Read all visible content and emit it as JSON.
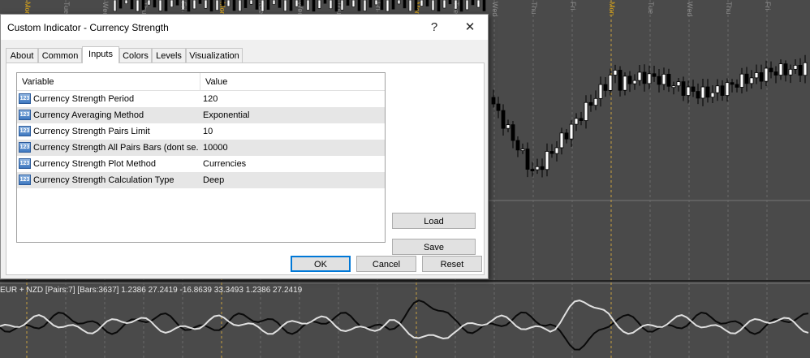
{
  "window": {
    "title": "Custom Indicator - Currency Strength",
    "help": "?",
    "close": "✕"
  },
  "tabs": [
    {
      "label": "About"
    },
    {
      "label": "Common"
    },
    {
      "label": "Inputs"
    },
    {
      "label": "Colors"
    },
    {
      "label": "Levels"
    },
    {
      "label": "Visualization"
    }
  ],
  "active_tab": "Inputs",
  "grid": {
    "headers": {
      "variable": "Variable",
      "value": "Value"
    },
    "rows": [
      {
        "name": "Currency Strength Period",
        "value": "120"
      },
      {
        "name": "Currency Averaging Method",
        "value": "Exponential"
      },
      {
        "name": "Currency Strength Pairs Limit",
        "value": "10"
      },
      {
        "name": "Currency Strength All Pairs Bars (dont se...",
        "value": "10000"
      },
      {
        "name": "Currency Strength Plot Method",
        "value": "Currencies"
      },
      {
        "name": "Currency Strength Calculation Type",
        "value": "Deep"
      }
    ],
    "icon_text": "123"
  },
  "buttons": {
    "load": "Load",
    "save": "Save",
    "ok": "OK",
    "cancel": "Cancel",
    "reset": "Reset"
  },
  "chart": {
    "indicator_label": "EUR + NZD [Pairs:7] [Bars:3637] 1.2386 27.2419 -16.8639 33.3493 1.2386 27.2419",
    "day_labels": [
      "Mon",
      "Tue",
      "Wed",
      "Thu",
      "Fri",
      "Mon",
      "Tue",
      "Wed",
      "Thu",
      "Fri",
      "Mon",
      "Tue",
      "Wed",
      "Thu",
      "Fri",
      "Mon",
      "Tue",
      "Wed",
      "Thu",
      "Fri"
    ],
    "colors": {
      "background": "#4a4a4a",
      "day_label": "#8c8c8c",
      "mon_label": "#d4a017",
      "up_candle": "#ffffff",
      "down_candle": "#000000"
    }
  }
}
